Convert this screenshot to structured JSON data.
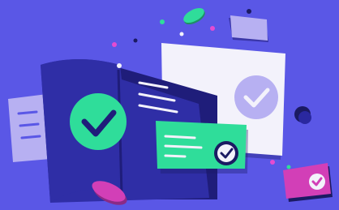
{
  "scene": {
    "background_color": "#5a57e6",
    "icons": [
      "document-with-checkmark-icon",
      "checklist-card-icon",
      "approval-card-icon",
      "back-document-icon",
      "badge-checkmark-icon",
      "coin-icon"
    ],
    "colors": {
      "document_blue": "#2f2ea6",
      "document_dark": "#1f1d7a",
      "accent_green": "#2fdd9a",
      "white_card": "#f3f2fb",
      "lavender": "#b7b0f2",
      "pink": "#e44bd1",
      "magenta": "#d23fb7",
      "navy": "#1b1a63"
    }
  }
}
